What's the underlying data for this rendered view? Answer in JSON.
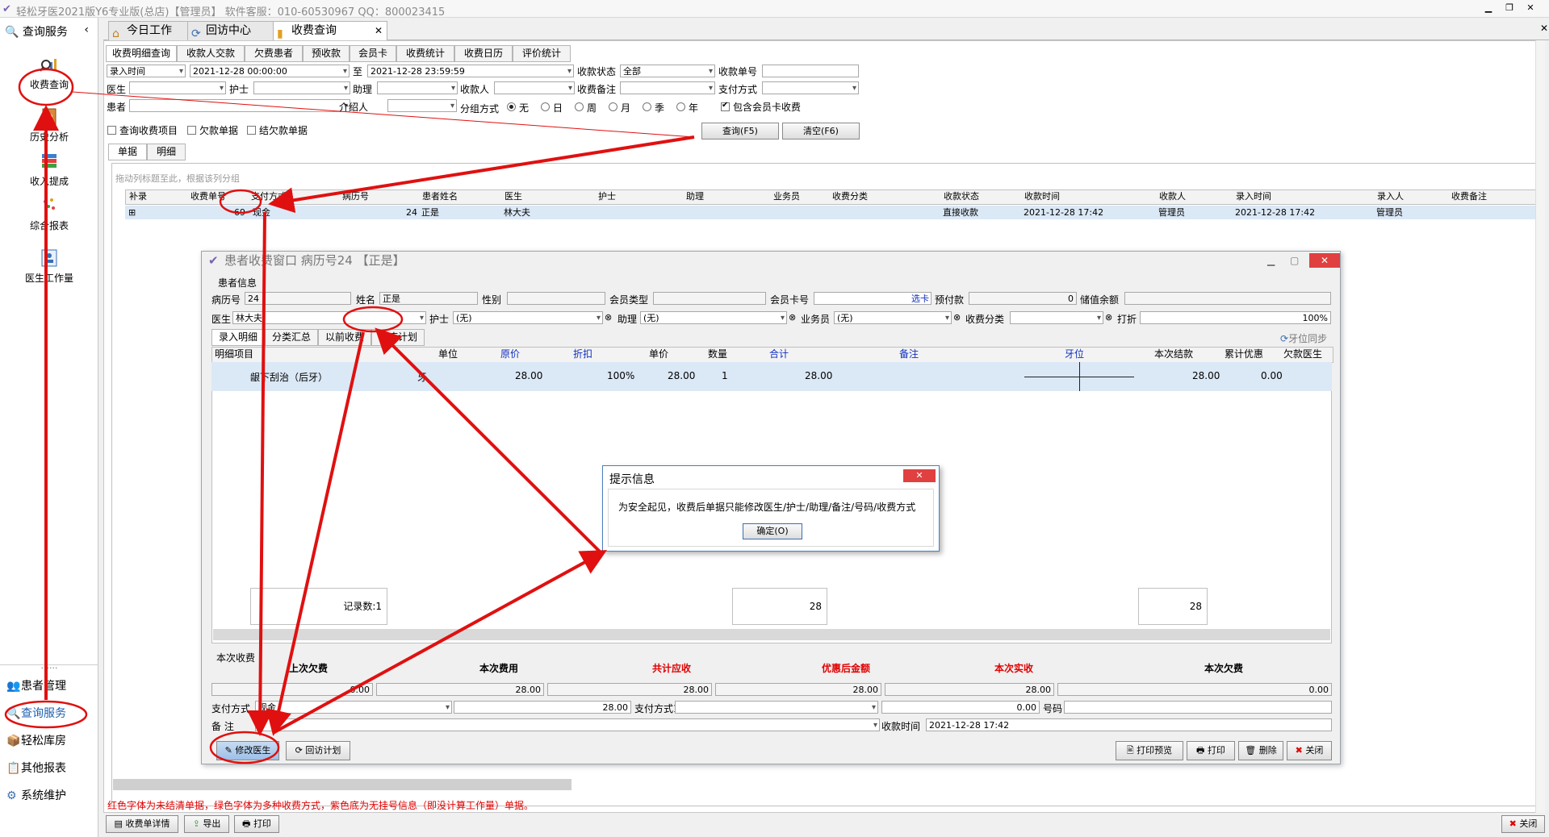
{
  "window": {
    "title": "轻松牙医2021版Y6专业版(总店)【管理员】    软件客服：010-60530967  QQ：800023415"
  },
  "sidebar": {
    "header": "查询服务",
    "items": [
      {
        "label": "收费查询"
      },
      {
        "label": "历史分析"
      },
      {
        "label": "收入提成"
      },
      {
        "label": "综合报表"
      },
      {
        "label": "医生工作量"
      }
    ],
    "divider": "......",
    "bottom": [
      {
        "label": "患者管理"
      },
      {
        "label": "查询服务"
      },
      {
        "label": "轻松库房"
      },
      {
        "label": "其他报表"
      },
      {
        "label": "系统维护"
      }
    ]
  },
  "doc_tabs": [
    "今日工作",
    "回访中心",
    "收费查询"
  ],
  "sub_tabs": [
    "收费明细查询",
    "收款人交款",
    "欠费患者",
    "预收款",
    "会员卡",
    "收费统计",
    "收费日历",
    "评价统计"
  ],
  "filters": {
    "time_type": "录入时间",
    "from": "2021-12-28 00:00:00",
    "to_label": "至",
    "to": "2021-12-28 23:59:59",
    "status_label": "收款状态",
    "status": "全部",
    "receipt_label": "收款单号",
    "doctor_label": "医生",
    "nurse_label": "护士",
    "assist_label": "助理",
    "payee_label": "收款人",
    "note_label": "收费备注",
    "paymethod_label": "支付方式",
    "patient_label": "患者",
    "referrer_label": "介绍人",
    "group_label": "分组方式",
    "group_options": [
      "无",
      "日",
      "周",
      "月",
      "季",
      "年"
    ],
    "include_member": "包含会员卡收费",
    "checks": [
      "查询收费项目",
      "欠款单据",
      "结欠款单据"
    ],
    "query_btn": "查询(F5)",
    "clear_btn": "清空(F6)"
  },
  "result_tabs": [
    "单据",
    "明细"
  ],
  "drag_hint": "拖动列标题至此，根据该列分组",
  "grid": {
    "headers": [
      "补录",
      "收费单号",
      "支付方式",
      "病历号",
      "患者姓名",
      "医生",
      "护士",
      "助理",
      "业务员",
      "收费分类",
      "收款状态",
      "收款时间",
      "收款人",
      "录入时间",
      "录入人",
      "收费备注"
    ],
    "row": {
      "expand": "⊞",
      "receipt": "69",
      "paymethod": "现金",
      "record": "24",
      "patient": "正是",
      "doctor": "林大夫",
      "status": "直接收款",
      "paytime": "2021-12-28 17:42",
      "payee": "管理员",
      "entrytime": "2021-12-28 17:42",
      "entry_by": "管理员"
    }
  },
  "dialog": {
    "title": "患者收费窗口  病历号24 【正是】",
    "patient_info": "患者信息",
    "record_label": "病历号",
    "record": "24",
    "name_label": "姓名",
    "name": "正是",
    "gender_label": "性别",
    "member_type_label": "会员类型",
    "card_label": "会员卡号",
    "card_btn": "选卡",
    "prepay_label": "预付款",
    "prepay": "0",
    "balance_label": "储值余额",
    "doctor_label": "医生",
    "doctor": "林大夫",
    "nurse_label": "护士",
    "nurse": "(无)",
    "assist_label": "助理",
    "assist": "(无)",
    "sales_label": "业务员",
    "sales": "(无)",
    "category_label": "收费分类",
    "discount_label": "打折",
    "discount": "100%",
    "tabs": [
      "录入明细",
      "分类汇总",
      "以前收费",
      "治疗计划"
    ],
    "tooth_sync": "牙位同步",
    "table_headers": [
      "明细项目",
      "单位",
      "原价",
      "折扣",
      "单价",
      "数量",
      "合计",
      "备注",
      "牙位",
      "本次结款",
      "累计优惠",
      "欠款医生"
    ],
    "row": {
      "item": "龈下刮治（后牙）",
      "unit": "牙",
      "price": "28.00",
      "discount": "100%",
      "unit_price": "28.00",
      "qty": "1",
      "total": "28.00",
      "settle": "28.00",
      "accum": "0.00"
    },
    "summary": {
      "records": "记录数:1",
      "total1": "28",
      "total2": "28"
    },
    "this_fee": "本次收费",
    "fee_headers": [
      "上次欠费",
      "本次费用",
      "共计应收",
      "优惠后金额",
      "本次实收",
      "本次欠费"
    ],
    "fee_values": [
      "0.00",
      "28.00",
      "28.00",
      "28.00",
      "28.00",
      "0.00"
    ],
    "pay_label": "支付方式",
    "pay_value": "现金",
    "pay_amount": "28.00",
    "pay1_label": "支付方式1",
    "pay1_amount": "0.00",
    "number_label": "号码",
    "note_label": "备  注",
    "paytime_label": "收款时间",
    "paytime": "2021-12-28 17:42",
    "buttons": {
      "edit_doctor": "修改医生",
      "revisit": "回访计划",
      "print_preview": "打印预览",
      "print": "打印",
      "delete": "删除",
      "close": "关闭"
    }
  },
  "message": {
    "title": "提示信息",
    "text": "为安全起见，收费后单据只能修改医生/护士/助理/备注/号码/收费方式",
    "ok": "确定(O)"
  },
  "status_text": "红色字体为未结清单据，绿色字体为多种收费方式，紫色底为无挂号信息（即没计算工作量）单据。",
  "footer": {
    "detail": "收费单详情",
    "export": "导出",
    "print": "打印",
    "close": "关闭"
  }
}
